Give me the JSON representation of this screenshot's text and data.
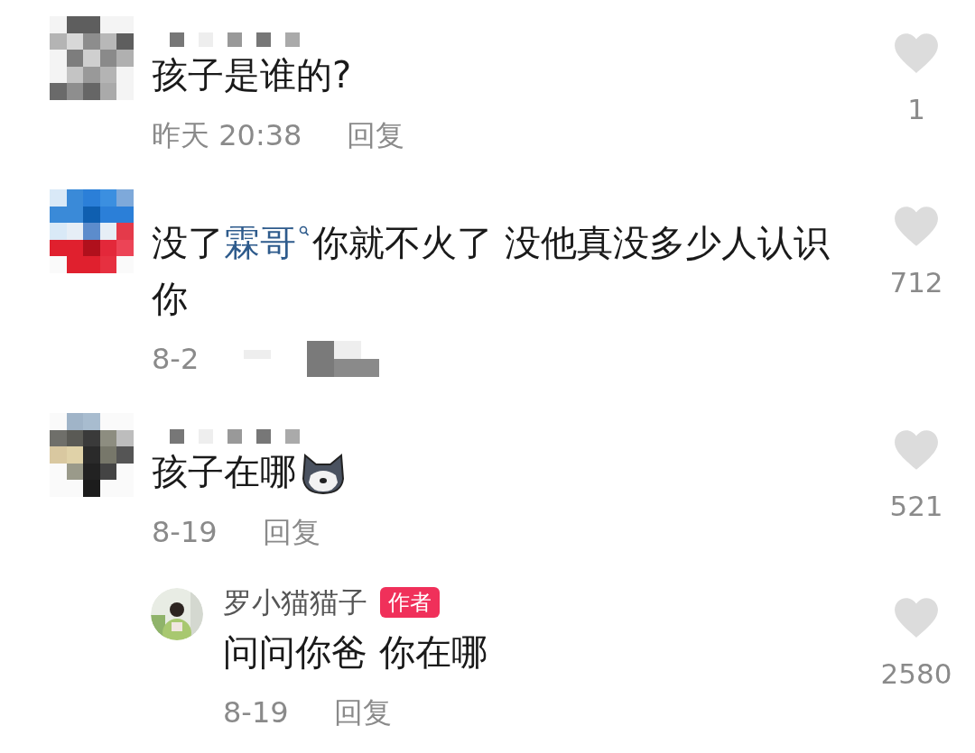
{
  "comments": [
    {
      "segments": [
        {
          "kind": "plain",
          "text": "孩子是谁的?"
        }
      ],
      "time": "昨天 20:38",
      "reply_label": "回复",
      "likes": "1",
      "obscured": false
    },
    {
      "segments": [
        {
          "kind": "plain",
          "text": "没了"
        },
        {
          "kind": "link",
          "text": "霖哥"
        },
        {
          "kind": "plain",
          "text": "你就不火了 没他真没多少人认识你"
        }
      ],
      "time": "8-2",
      "likes": "712",
      "obscured": true
    },
    {
      "segments": [
        {
          "kind": "plain",
          "text": "孩子在哪"
        },
        {
          "kind": "emoji"
        }
      ],
      "time": "8-19",
      "reply_label": "回复",
      "likes": "521",
      "obscured": false,
      "replies": [
        {
          "author": "罗小猫猫子",
          "badge": "作者",
          "segments": [
            {
              "kind": "plain",
              "text": "问问你爸 你在哪"
            }
          ],
          "time": "8-19",
          "reply_label": "回复",
          "likes": "2580"
        }
      ]
    }
  ]
}
